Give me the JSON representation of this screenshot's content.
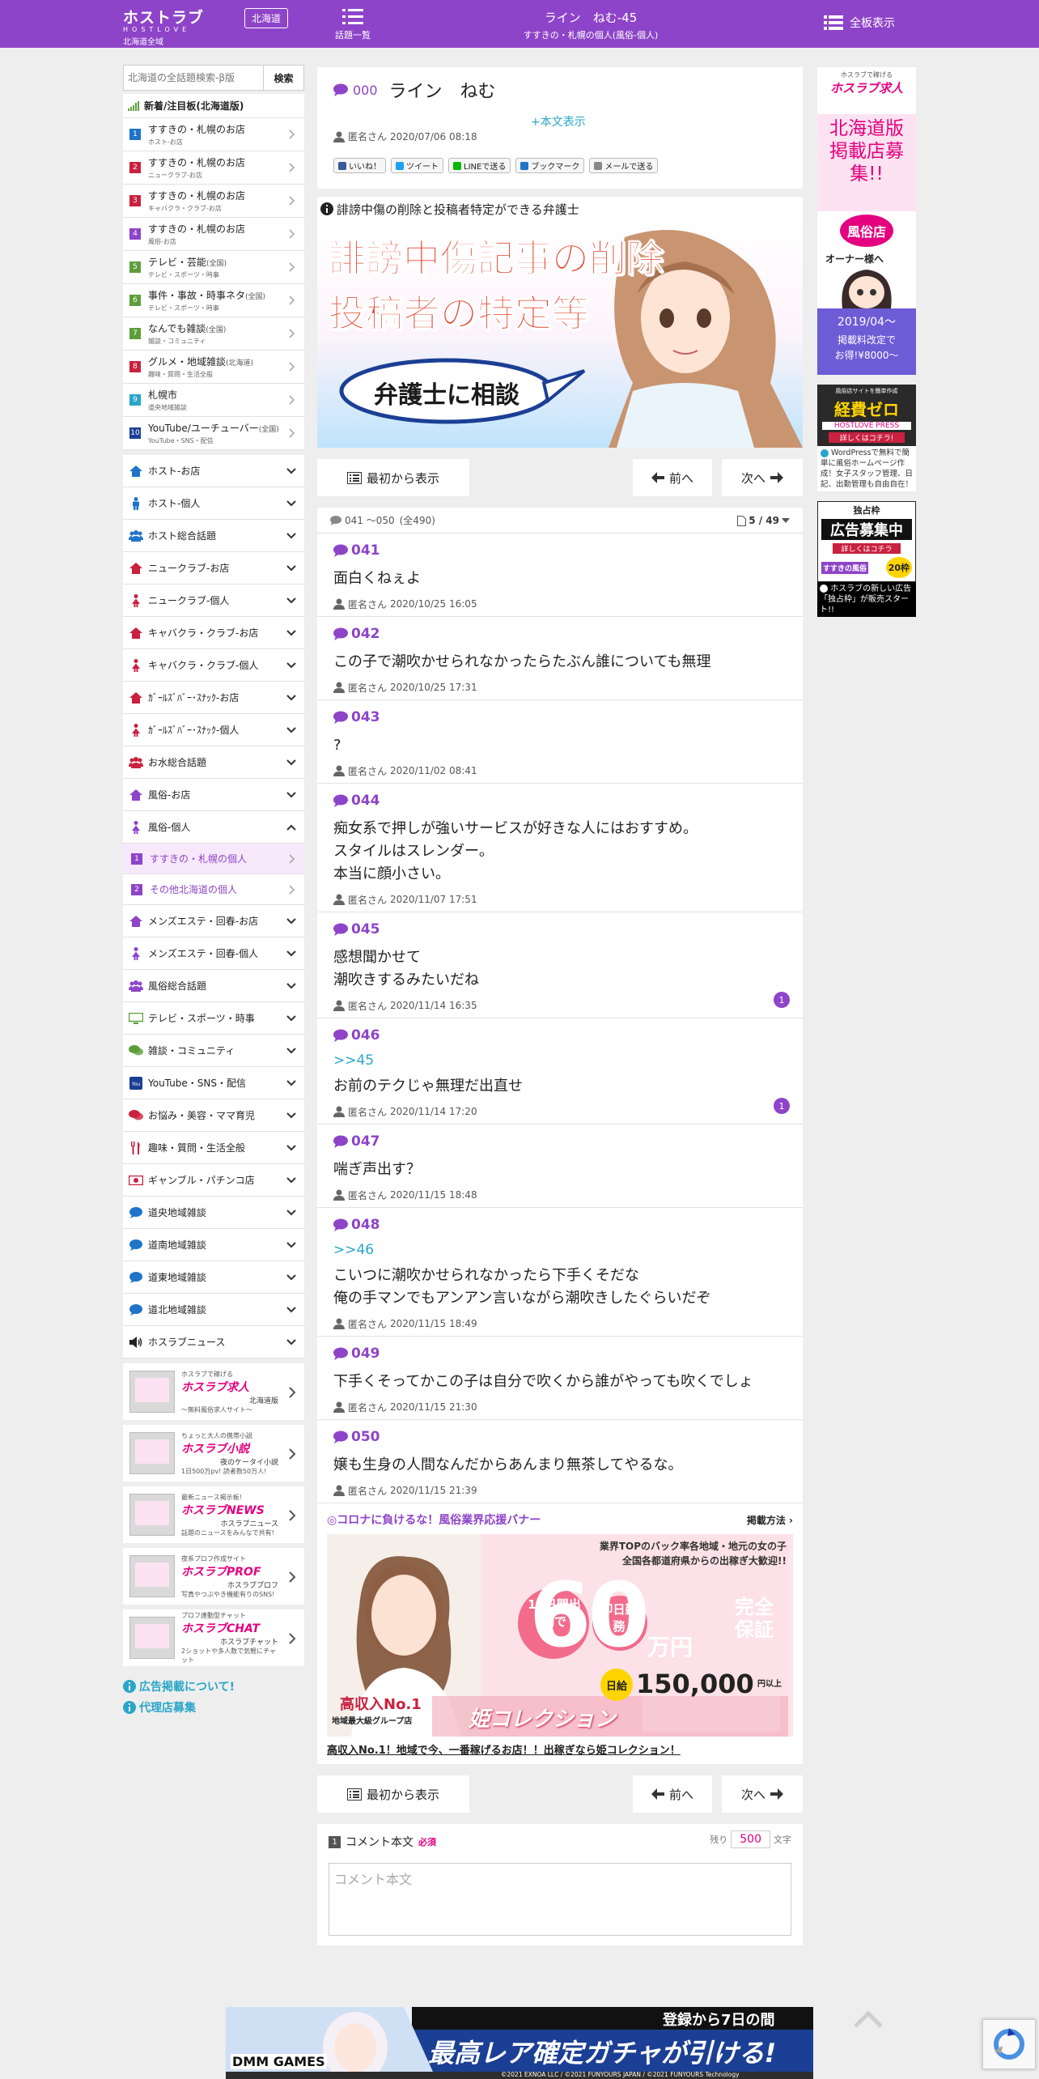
{
  "header": {
    "logo": "ホストラブ",
    "logo_sub": "HOSTLOVE",
    "logo_region": "北海道全域",
    "region_button": "北海道",
    "topics_label": "話題一覧",
    "thread_title": "ライン　ねむ-45",
    "thread_category": "すすきの・札幌の個人(風俗-個人)",
    "all_boards_label": "全板表示"
  },
  "sidebar": {
    "search_placeholder": "北海道の全話題検索-β版",
    "search_button": "検索",
    "new_boards_heading": "新着/注目板(北海道版)",
    "new_boards": [
      {
        "num": "1",
        "title": "すすきの・札幌のお店",
        "note": "",
        "sub": "ホスト-お店",
        "color": "#1f74c9"
      },
      {
        "num": "2",
        "title": "すすきの・札幌のお店",
        "note": "",
        "sub": "ニュークラブ-お店",
        "color": "#c9213f"
      },
      {
        "num": "3",
        "title": "すすきの・札幌のお店",
        "note": "",
        "sub": "キャバクラ・クラブ-お店",
        "color": "#c9213f"
      },
      {
        "num": "4",
        "title": "すすきの・札幌のお店",
        "note": "",
        "sub": "風俗-お店",
        "color": "#8e44c8"
      },
      {
        "num": "5",
        "title": "テレビ・芸能",
        "note": "(全国)",
        "sub": "テレビ・スポーツ・時事",
        "color": "#5c9e3a"
      },
      {
        "num": "6",
        "title": "事件・事故・時事ネタ",
        "note": "(全国)",
        "sub": "テレビ・スポーツ・時事",
        "color": "#5c9e3a"
      },
      {
        "num": "7",
        "title": "なんでも雑談",
        "note": "(全国)",
        "sub": "雑談・コミュニティ",
        "color": "#5c9e3a"
      },
      {
        "num": "8",
        "title": "グルメ・地域雑談",
        "note": "(北海道)",
        "sub": "趣味・質問・生活全般",
        "color": "#c9213f"
      },
      {
        "num": "9",
        "title": "札幌市",
        "note": "",
        "sub": "道央地域雑談",
        "color": "#2aa6c9"
      },
      {
        "num": "10",
        "title": "YouTube/ユーチューバー",
        "note": "(全国)",
        "sub": "YouTube・SNS・配信",
        "color": "#1b3f94"
      }
    ],
    "categories_top": [
      {
        "icon": "house",
        "color": "#1f74c9",
        "label": "ホスト-お店"
      },
      {
        "icon": "male",
        "color": "#1f74c9",
        "label": "ホスト-個人"
      },
      {
        "icon": "group",
        "color": "#1f74c9",
        "label": "ホスト総合話題"
      },
      {
        "icon": "house",
        "color": "#c9213f",
        "label": "ニュークラブ-お店"
      },
      {
        "icon": "female",
        "color": "#c9213f",
        "label": "ニュークラブ-個人"
      },
      {
        "icon": "house",
        "color": "#c9213f",
        "label": "キャバクラ・クラブ-お店"
      },
      {
        "icon": "female",
        "color": "#c9213f",
        "label": "キャバクラ・クラブ-個人"
      },
      {
        "icon": "house",
        "color": "#c9213f",
        "label": "ｶﾞｰﾙｽﾞﾊﾞｰ･ｽﾅｯｸ-お店"
      },
      {
        "icon": "female",
        "color": "#c9213f",
        "label": "ｶﾞｰﾙｽﾞﾊﾞｰ･ｽﾅｯｸ-個人"
      },
      {
        "icon": "group",
        "color": "#c9213f",
        "label": "お水総合話題"
      },
      {
        "icon": "house",
        "color": "#8e44c8",
        "label": "風俗-お店"
      }
    ],
    "open_category": {
      "icon": "female",
      "color": "#8e44c8",
      "label": "風俗-個人"
    },
    "open_subitems": [
      {
        "num": "1",
        "label": "すすきの・札幌の個人"
      },
      {
        "num": "2",
        "label": "その他北海道の個人"
      }
    ],
    "categories_bottom": [
      {
        "icon": "house",
        "color": "#8e44c8",
        "label": "メンズエステ・回春-お店"
      },
      {
        "icon": "female",
        "color": "#8e44c8",
        "label": "メンズエステ・回春-個人"
      },
      {
        "icon": "group",
        "color": "#8e44c8",
        "label": "風俗総合話題"
      },
      {
        "icon": "tv",
        "color": "#5c9e3a",
        "label": "テレビ・スポーツ・時事"
      },
      {
        "icon": "chat",
        "color": "#5c9e3a",
        "label": "雑談・コミュニティ"
      },
      {
        "icon": "youtube",
        "color": "#1b3f94",
        "label": "YouTube・SNS・配信"
      },
      {
        "icon": "chat",
        "color": "#c9213f",
        "label": "お悩み・美容・ママ育児"
      },
      {
        "icon": "fork",
        "color": "#c9213f",
        "label": "趣味・質問・生活全般"
      },
      {
        "icon": "money",
        "color": "#c9213f",
        "label": "ギャンブル・パチンコ店"
      },
      {
        "icon": "bubble",
        "color": "#1f74c9",
        "label": "道央地域雑談"
      },
      {
        "icon": "bubble",
        "color": "#1f74c9",
        "label": "道南地域雑談"
      },
      {
        "icon": "bubble",
        "color": "#1f74c9",
        "label": "道東地域雑談"
      },
      {
        "icon": "bubble",
        "color": "#1f74c9",
        "label": "道北地域雑談"
      },
      {
        "icon": "speaker",
        "color": "#222222",
        "label": "ホスラブニュース"
      }
    ],
    "service_banners": [
      {
        "tag": "ホスラブで稼げる",
        "name": "ホスラブ求人",
        "sub": "北海道版",
        "desc": "〜無料風俗求人サイト〜"
      },
      {
        "tag": "ちょっと大人の携帯小説",
        "name": "ホスラブ小説",
        "sub": "夜のケータイ小説",
        "desc": "1日500万pv! 読者数50万人!"
      },
      {
        "tag": "最新ニュース掲示板!",
        "name": "ホスラブNEWS",
        "sub": "ホスラブニュース",
        "desc": "話題のニュースをみんなで共有!"
      },
      {
        "tag": "夜系プロフ作成サイト",
        "name": "ホスラブPROF",
        "sub": "ホスラブプロフ",
        "desc": "写真やつぶやき機能有りのSNS!"
      },
      {
        "tag": "プロフ連動型チャット",
        "name": "ホスラブCHAT",
        "sub": "ホスラブチャット",
        "desc": "2ショットや多人数で気軽にチャット"
      }
    ],
    "links": [
      "広告掲載について!",
      "代理店募集"
    ]
  },
  "thread": {
    "title_num": "000",
    "title": "ライン　ねむ",
    "more_text": "+本文表示",
    "author": "匿名さん",
    "date": "2020/07/06 08:18",
    "share": [
      {
        "label": "いいね！",
        "color": "#3b5998"
      },
      {
        "label": "ツイート",
        "color": "#1da1f2"
      },
      {
        "label": "LINEで送る",
        "color": "#00b900"
      },
      {
        "label": "ブックマーク",
        "color": "#1f74c9"
      },
      {
        "label": "メールで送る",
        "color": "#888888"
      }
    ]
  },
  "lawyer": {
    "heading": "誹謗中傷の削除と投稿者特定ができる弁護士",
    "line1": "誹謗中傷記事の削除",
    "line2": "投稿者の特定等",
    "bubble": "弁護士に相談"
  },
  "nav": {
    "first": "最初から表示",
    "prev": "前へ",
    "next": "次へ"
  },
  "list": {
    "range": "041 ～050",
    "total": "(全490)",
    "pages": "5 / 49",
    "posts": [
      {
        "num": "041",
        "quote": "",
        "body": "面白くねぇよ",
        "author": "匿名さん",
        "date": "2020/10/25 16:05",
        "replies": ""
      },
      {
        "num": "042",
        "quote": "",
        "body": "この子で潮吹かせられなかったらたぶん誰についても無理",
        "author": "匿名さん",
        "date": "2020/10/25 17:31",
        "replies": ""
      },
      {
        "num": "043",
        "quote": "",
        "body": "?",
        "author": "匿名さん",
        "date": "2020/11/02 08:41",
        "replies": ""
      },
      {
        "num": "044",
        "quote": "",
        "body": "痴女系で押しが強いサービスが好きな人にはおすすめ。\nスタイルはスレンダー。\n本当に顔小さい。",
        "author": "匿名さん",
        "date": "2020/11/07 17:51",
        "replies": ""
      },
      {
        "num": "045",
        "quote": "",
        "body": "感想聞かせて\n潮吹きするみたいだね",
        "author": "匿名さん",
        "date": "2020/11/14 16:35",
        "replies": "1"
      },
      {
        "num": "046",
        "quote": ">>45",
        "body": "お前のテクじゃ無理だ出直せ",
        "author": "匿名さん",
        "date": "2020/11/14 17:20",
        "replies": "1"
      },
      {
        "num": "047",
        "quote": "",
        "body": "喘ぎ声出す？",
        "author": "匿名さん",
        "date": "2020/11/15 18:48",
        "replies": ""
      },
      {
        "num": "048",
        "quote": ">>46",
        "body": "こいつに潮吹かせられなかったら下手くそだな\n俺の手マンでもアンアン言いながら潮吹きしたぐらいだぞ",
        "author": "匿名さん",
        "date": "2020/11/15 18:49",
        "replies": ""
      },
      {
        "num": "049",
        "quote": "",
        "body": "下手くそってかこの子は自分で吹くから誰がやっても吹くでしょ",
        "author": "匿名さん",
        "date": "2020/11/15 21:30",
        "replies": ""
      },
      {
        "num": "050",
        "quote": "",
        "body": "嬢も生身の人間なんだからあんまり無茶してやるな。",
        "author": "匿名さん",
        "date": "2020/11/15 21:39",
        "replies": ""
      }
    ]
  },
  "ad": {
    "heading": "◎コロナに負けるな！風俗業界応援バナー",
    "method": "掲載方法",
    "copy_top1": "業界TOPのバック率各地域・地元の女の子",
    "copy_top2": "全国各都道府県からの出稼ぎ大歓迎!!",
    "days": "10日間出勤で",
    "big": "60",
    "unit": "万円",
    "guarantee": "完全保証",
    "daily_label": "日給",
    "daily": "150,000",
    "daily_unit": "円以上",
    "badge": "即日勤務",
    "high_income": "高収入No.1",
    "group": "地域最大級グループ店",
    "brand": "姫コレクション",
    "link_text": "高収入No.1！地域で今、一番稼げるお店！！出稼ぎなら姫コレクション！"
  },
  "comment": {
    "step": "1",
    "label": "コメント本文",
    "required": "必須",
    "remain_label": "残り",
    "remain_value": "500",
    "remain_unit": "文字",
    "placeholder": "コメント本文"
  },
  "right_ads": {
    "ad1_tag": "ホスラブで稼げる",
    "ad1_brand": "ホスラブ求人",
    "ad1_text": "北海道版掲載店募集!!",
    "ad1_badge": "風俗店",
    "ad1_badge2": "オーナー様へ",
    "ad1_date": "2019/04〜",
    "ad1_price1": "掲載料改定で",
    "ad1_price2": "お得!¥8000〜",
    "ad2_tag": "風俗店サイトを簡単作成",
    "ad2_text": "経費ゼロ",
    "ad2_brand": "HOSTLOVE PRESS",
    "ad2_link": "詳しくはコチラ!",
    "ad2_caption": "WordPressで無料で簡単に風俗ホームページ作成！女子スタッフ管理、日記、出勤管理も自由自在！",
    "ad3_tag": "独占枠",
    "ad3_text": "広告募集中",
    "ad3_link": "詳しくはコチラ",
    "ad3_area": "すすきの風俗",
    "ad3_limit": "20枠",
    "ad3_caption": "ホスラブの新しい広告「独占枠」が販売スタート!!"
  },
  "bottom_ad": {
    "badge": "登録から7日の間",
    "main": "最高レア確定ガチャが引ける!",
    "brand": "DMM GAMES",
    "copyright": "©2021 EXNOA LLC / ©2021 FUNYOURS JAPAN / ©2021 FUNYOURS Technology"
  }
}
